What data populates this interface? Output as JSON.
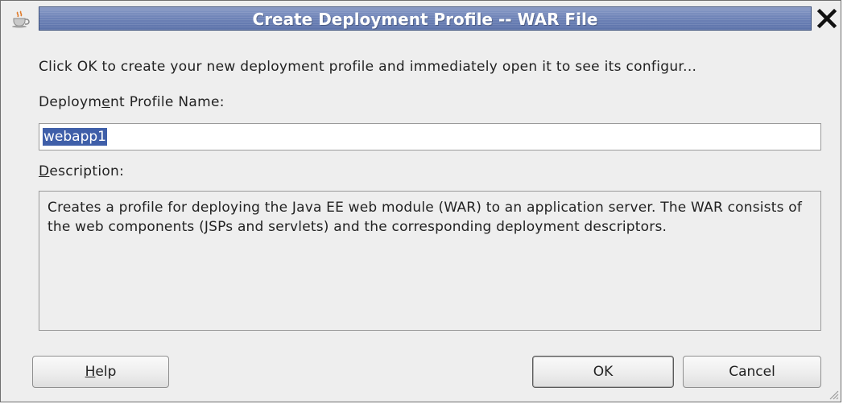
{
  "window": {
    "title": "Create Deployment Profile -- WAR File"
  },
  "intro_text": "Click OK to create your new deployment profile and immediately open it to see its configur...",
  "name_field": {
    "label_before": "Deploym",
    "label_mnemonic": "e",
    "label_after": "nt Profile Name:",
    "value": "webapp1"
  },
  "description": {
    "label_mnemonic": "D",
    "label_after": "escription:",
    "text": "Creates a profile for deploying the Java EE web module (WAR) to an application server. The WAR consists of the web components (JSPs and servlets) and the corresponding deployment descriptors."
  },
  "buttons": {
    "help_mnemonic": "H",
    "help_after": "elp",
    "ok": "OK",
    "cancel": "Cancel"
  },
  "colors": {
    "title_band": "#6f84b8",
    "selection": "#3f5fa9"
  }
}
